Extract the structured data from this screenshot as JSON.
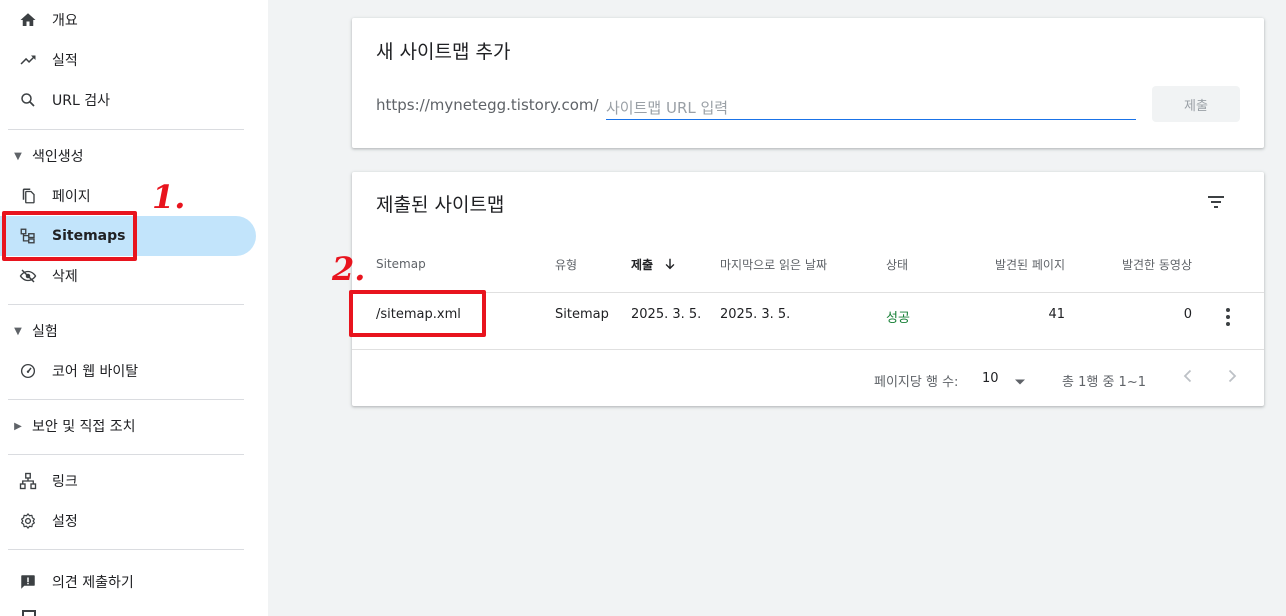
{
  "sidebar": {
    "top_items": [
      {
        "label": "개요",
        "icon": "home-icon"
      },
      {
        "label": "실적",
        "icon": "trending-up-icon"
      },
      {
        "label": "URL 검사",
        "icon": "search-icon"
      }
    ],
    "sections": [
      {
        "title": "색인생성",
        "expanded": true,
        "items": [
          {
            "label": "페이지",
            "icon": "pages-icon"
          },
          {
            "label": "Sitemaps",
            "icon": "sitemap-icon",
            "active": true
          },
          {
            "label": "삭제",
            "icon": "eye-off-icon"
          }
        ]
      },
      {
        "title": "실험",
        "expanded": true,
        "items": [
          {
            "label": "코어 웹 바이탈",
            "icon": "speedometer-icon"
          }
        ]
      },
      {
        "title": "보안 및 직접 조치",
        "expanded": false,
        "items": []
      }
    ],
    "bottom_items": [
      {
        "label": "링크",
        "icon": "links-icon"
      },
      {
        "label": "설정",
        "icon": "settings-icon"
      }
    ],
    "feedback": {
      "label": "의견 제출하기",
      "icon": "feedback-icon"
    }
  },
  "add_sitemap": {
    "title": "새 사이트맵 추가",
    "prefix": "https://mynetegg.tistory.com/",
    "placeholder": "사이트맵 URL 입력",
    "value": "",
    "submit_label": "제출"
  },
  "submitted": {
    "title": "제출된 사이트맵",
    "filter_icon": "filter-icon",
    "columns": [
      "Sitemap",
      "유형",
      "제출",
      "마지막으로 읽은 날짜",
      "상태",
      "발견된 페이지",
      "발견한 동영상"
    ],
    "sorted_column": "제출",
    "sort_icon": "arrow-down-icon",
    "rows": [
      {
        "sitemap": "/sitemap.xml",
        "type": "Sitemap",
        "submitted": "2025. 3. 5.",
        "last_read": "2025. 3. 5.",
        "status": "성공",
        "pages": "41",
        "videos": "0"
      }
    ],
    "footer": {
      "rows_per_page_label": "페이지당 행 수:",
      "rows_per_page": "10",
      "range": "총 1행 중 1~1"
    }
  },
  "annotations": {
    "label_1": "1.",
    "label_2": "2.",
    "color": "#e8141e"
  },
  "colors": {
    "accent": "#1a73e8",
    "active_bg": "#c2e4fb",
    "success": "#188038"
  }
}
